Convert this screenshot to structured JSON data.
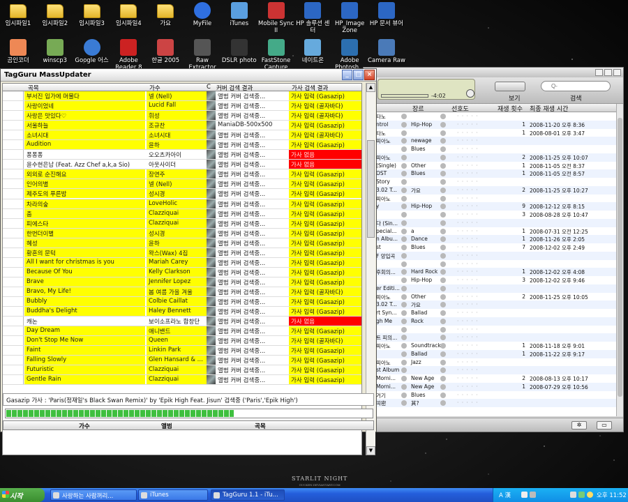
{
  "desktop": {
    "icons_row1": [
      {
        "label": "임시파일1",
        "icon": "folder-icon"
      },
      {
        "label": "임시파일2",
        "icon": "folder-icon"
      },
      {
        "label": "임시파일3",
        "icon": "folder-icon"
      },
      {
        "label": "임시파일4",
        "icon": "folder-icon"
      },
      {
        "label": "가요",
        "icon": "folder-icon"
      },
      {
        "label": "MyFile",
        "icon": "help-icon"
      },
      {
        "label": "iTunes",
        "icon": "itunes-icon"
      },
      {
        "label": "Mobile Sync II",
        "icon": "phone-icon"
      },
      {
        "label": "HP 솔루션 센터",
        "icon": "hp-icon"
      },
      {
        "label": "HP_Image Zone",
        "icon": "hp-image-icon"
      },
      {
        "label": "HP 문서 뷰어",
        "icon": "hp-doc-icon"
      }
    ],
    "icons_row2": [
      {
        "label": "곰인코더",
        "icon": "encoder-icon"
      },
      {
        "label": "winscp3",
        "icon": "winscp-icon"
      },
      {
        "label": "Google 어스",
        "icon": "globe-icon"
      },
      {
        "label": "Adobe Reader 8",
        "icon": "pdf-icon"
      },
      {
        "label": "한글 2005",
        "icon": "hangul-icon"
      },
      {
        "label": "Raw Extractor",
        "icon": "raw-icon"
      },
      {
        "label": "DSLR photo",
        "icon": "camera-icon"
      },
      {
        "label": "FastStone Capture",
        "icon": "capture-icon"
      },
      {
        "label": "네이트온",
        "icon": "nateon-icon"
      },
      {
        "label": "Adobe Photosh...",
        "icon": "photoshop-icon"
      },
      {
        "label": "Camera Raw",
        "icon": "camera-raw-icon"
      }
    ],
    "wallpaper_mark": "STARLIT NIGHT",
    "wallpaper_sub": "GUCKEN.DEVIANTART.COM"
  },
  "tagguru": {
    "title": "TagGuru MassUpdater",
    "columns": {
      "title": "곡목",
      "artist": "가수",
      "cover_short": "C",
      "cover": "커버 검색 결과",
      "lyric": "가사 검색 결과"
    },
    "rows": [
      {
        "title": "부서진 입가에 머물다",
        "artist": "넬 (Nell)",
        "cover": "앨범 커버 검색중...",
        "lyric": "가사 입력 (Gasazip)",
        "status": "ok"
      },
      {
        "title": "사랑이었네",
        "artist": "Lucid Fall",
        "cover": "앨범 커버 검색중...",
        "lyric": "가사 입력 (골자바다)",
        "status": "ok"
      },
      {
        "title": "사랑은 맛있다♡",
        "artist": "휘성",
        "cover": "앨범 커버 검색중...",
        "lyric": "가사 입력 (골자바다)",
        "status": "ok"
      },
      {
        "title": "서울하늘",
        "artist": "조규찬",
        "cover": "ManiaDB-500x500",
        "lyric": "가사 입력 (Gasazip)",
        "status": "ok"
      },
      {
        "title": "소녀시대",
        "artist": "소녀시대",
        "cover": "앨범 커버 검색중...",
        "lyric": "가사 입력 (골자바다)",
        "status": "ok"
      },
      {
        "title": "Audition",
        "artist": "윤하",
        "cover": "앨범 커버 검색중...",
        "lyric": "가사 입력 (Gasazip)",
        "status": "ok"
      },
      {
        "title": "퐁퐁퐁",
        "artist": "오오츠카아이",
        "cover": "앨범 커버 검색중...",
        "lyric": "가사 없음",
        "status": "err"
      },
      {
        "title": "윤수현은남 (Feat. Azz Chef a,k,a Sio)",
        "artist": "아웃사이더",
        "cover": "앨범 커버 검색중...",
        "lyric": "가사 없음",
        "status": "err"
      },
      {
        "title": "외외로 순진해요",
        "artist": "장연주",
        "cover": "앨범 커버 검색중...",
        "lyric": "가사 입력 (Gasazip)",
        "status": "ok"
      },
      {
        "title": "인어의별",
        "artist": "넬 (Nell)",
        "cover": "앨범 커버 검색중...",
        "lyric": "가사 입력 (Gasazip)",
        "status": "ok"
      },
      {
        "title": "제주도의 푸른밤",
        "artist": "성시경",
        "cover": "앨범 커버 검색중...",
        "lyric": "가사 입력 (Gasazip)",
        "status": "ok"
      },
      {
        "title": "차라의숲",
        "artist": "LoveHolic",
        "cover": "앨범 커버 검색중...",
        "lyric": "가사 입력 (Gasazip)",
        "status": "ok"
      },
      {
        "title": "춤",
        "artist": "Clazziquai",
        "cover": "앨범 커버 검색중...",
        "lyric": "가사 입력 (Gasazip)",
        "status": "ok"
      },
      {
        "title": "피에스타",
        "artist": "Clazziquai",
        "cover": "앨범 커버 검색중...",
        "lyric": "가사 입력 (Gasazip)",
        "status": "ok"
      },
      {
        "title": "한번더이별",
        "artist": "성시경",
        "cover": "앨범 커버 검색중...",
        "lyric": "가사 입력 (Gasazip)",
        "status": "ok"
      },
      {
        "title": "혜성",
        "artist": "윤하",
        "cover": "앨범 커버 검색중...",
        "lyric": "가사 입력 (Gasazip)",
        "status": "ok"
      },
      {
        "title": "황혼의 문턱",
        "artist": "왁스(Wax) 4집",
        "cover": "앨범 커버 검색중...",
        "lyric": "가사 입력 (Gasazip)",
        "status": "ok"
      },
      {
        "title": "All I want for christmas is you",
        "artist": "Mariah Carey",
        "cover": "앨범 커버 검색중...",
        "lyric": "가사 입력 (Gasazip)",
        "status": "ok"
      },
      {
        "title": "Because Of You",
        "artist": "Kelly Clarkson",
        "cover": "앨범 커버 검색중...",
        "lyric": "가사 입력 (Gasazip)",
        "status": "ok"
      },
      {
        "title": "Brave",
        "artist": "Jennifer Lopez",
        "cover": "앨범 커버 검색중...",
        "lyric": "가사 입력 (Gasazip)",
        "status": "ok"
      },
      {
        "title": "Bravo, My Life!",
        "artist": "봄 여름 가을 겨울",
        "cover": "앨범 커버 검색중...",
        "lyric": "가사 입력 (골자바다)",
        "status": "ok"
      },
      {
        "title": "Bubbly",
        "artist": "Colbie Caillat",
        "cover": "앨범 커버 검색중...",
        "lyric": "가사 입력 (Gasazip)",
        "status": "ok"
      },
      {
        "title": "Buddha's Delight",
        "artist": "Haley Bennett",
        "cover": "앨범 커버 검색중...",
        "lyric": "가사 입력 (Gasazip)",
        "status": "ok"
      },
      {
        "title": "캐논",
        "artist": "보이소프라노 합창단",
        "cover": "앨범 커버 검색중...",
        "lyric": "가사 없음",
        "status": "err"
      },
      {
        "title": "Day Dream",
        "artist": "애니밴드",
        "cover": "앨범 커버 검색중...",
        "lyric": "가사 입력 (Gasazip)",
        "status": "ok"
      },
      {
        "title": "Don't Stop Me Now",
        "artist": "Queen",
        "cover": "앨범 커버 검색중...",
        "lyric": "가사 입력 (골자바다)",
        "status": "ok"
      },
      {
        "title": "Faint",
        "artist": "Linkin Park",
        "cover": "앨범 커버 검색중...",
        "lyric": "가사 입력 (Gasazip)",
        "status": "ok"
      },
      {
        "title": "Falling Slowly",
        "artist": "Glen Hansard & ...",
        "cover": "앨범 커버 검색중...",
        "lyric": "가사 입력 (Gasazip)",
        "status": "ok"
      },
      {
        "title": "Futuristic",
        "artist": "Clazziquai",
        "cover": "앨범 커버 검색중...",
        "lyric": "가사 입력 (Gasazip)",
        "status": "ok"
      },
      {
        "title": "Gentle Rain",
        "artist": "Clazziquai",
        "cover": "앨범 커버 검색중...",
        "lyric": "가사 입력 (Gasazip)",
        "status": "ok"
      }
    ],
    "status_text": "Gasazip 가사 : 'Paris(정재일's Black Swan Remix)' by 'Epik High Feat. Jisun' 검색중 ('Paris','Epik High')",
    "progress_fraction": 0.62,
    "bottom": {
      "artist": "가수",
      "album": "앨범",
      "title": "곡목"
    }
  },
  "itunes": {
    "time": "-4:02",
    "view_label": "보기",
    "search_placeholder": "Q-",
    "search_label": "검색",
    "columns": {
      "genre": "장르",
      "rating": "선호도",
      "plays": "재생 횟수",
      "last_played": "최종 재생 시간"
    },
    "rows": [
      {
        "album": "타노",
        "genre": "",
        "plays": "",
        "last": ""
      },
      {
        "album": "ntrol",
        "genre": "Hip-Hop",
        "plays": "1",
        "last": "2008-11-20 오후 8:36"
      },
      {
        "album": "타노",
        "genre": "",
        "plays": "1",
        "last": "2008-08-01 오후 3:47"
      },
      {
        "album": "피아노",
        "genre": "newage",
        "plays": "",
        "last": ""
      },
      {
        "album": "",
        "genre": "Blues",
        "plays": "",
        "last": ""
      },
      {
        "album": "피아노",
        "genre": "",
        "plays": "2",
        "last": "2008-11-25 오후 10:07"
      },
      {
        "album": "(Single)",
        "genre": "Other",
        "plays": "1",
        "last": "2008-11-05 오전 8:37"
      },
      {
        "album": "OST",
        "genre": "Blues",
        "plays": "1",
        "last": "2008-11-05 오전 8:57"
      },
      {
        "album": "Story",
        "genre": "",
        "plays": "",
        "last": ""
      },
      {
        "album": "3.02 T...",
        "genre": "가요",
        "plays": "2",
        "last": "2008-11-25 오후 10:27"
      },
      {
        "album": "피아노",
        "genre": "",
        "plays": "",
        "last": ""
      },
      {
        "album": "y",
        "genre": "Hip-Hop",
        "plays": "9",
        "last": "2008-12-12 오후 8:15"
      },
      {
        "album": "",
        "genre": "",
        "plays": "3",
        "last": "2008-08-28 오후 10:47"
      },
      {
        "album": "다 (Sin...",
        "genre": "",
        "plays": "",
        "last": ""
      },
      {
        "album": "pecial...",
        "genre": "a",
        "plays": "1",
        "last": "2008-07-31 오전 12:25"
      },
      {
        "album": "n Albu...",
        "genre": "Dance",
        "plays": "1",
        "last": "2008-11-26 오후 2:05"
      },
      {
        "album": "st",
        "genre": "Blues",
        "plays": "7",
        "last": "2008-12-02 오후 2:49"
      },
      {
        "album": "F 앙입곡",
        "genre": "",
        "plays": "",
        "last": ""
      },
      {
        "album": "",
        "genre": "",
        "plays": "",
        "last": ""
      },
      {
        "album": "후회의...",
        "genre": "Hard Rock",
        "plays": "1",
        "last": "2008-12-02 오후 4:08"
      },
      {
        "album": "",
        "genre": "Hip-Hop",
        "plays": "3",
        "last": "2008-12-02 오후 9:46"
      },
      {
        "album": "er Editi...",
        "genre": "",
        "plays": "",
        "last": ""
      },
      {
        "album": "피아노",
        "genre": "Other",
        "plays": "2",
        "last": "2008-11-25 오후 10:05"
      },
      {
        "album": "3.02 T...",
        "genre": "가요",
        "plays": "",
        "last": ""
      },
      {
        "album": "rt Syn...",
        "genre": "Ballad",
        "plays": "",
        "last": ""
      },
      {
        "album": "gh Me",
        "genre": "Rock",
        "plays": "",
        "last": ""
      },
      {
        "album": "",
        "genre": "",
        "plays": "",
        "last": ""
      },
      {
        "album": "트 피의...",
        "genre": "",
        "plays": "",
        "last": ""
      },
      {
        "album": "피아노",
        "genre": "Soundtrack",
        "plays": "1",
        "last": "2008-11-18 오후 9:01"
      },
      {
        "album": "",
        "genre": "Ballad",
        "plays": "1",
        "last": "2008-11-22 오후 9:17"
      },
      {
        "album": "피아노",
        "genre": "Jazz",
        "plays": "",
        "last": ""
      },
      {
        "album": "st Album",
        "genre": "",
        "plays": "",
        "last": ""
      },
      {
        "album": "Morni...",
        "genre": "New Age",
        "plays": "2",
        "last": "2008-08-13 오후 10:17"
      },
      {
        "album": "Morni...",
        "genre": "New Age",
        "plays": "1",
        "last": "2008-07-29 오후 10:56"
      },
      {
        "album": "거기",
        "genre": "Blues",
        "plays": "",
        "last": ""
      },
      {
        "album": "띠密",
        "genre": "其?",
        "plays": "",
        "last": ""
      }
    ]
  },
  "taskbar": {
    "start_label": "시작",
    "tasks": [
      {
        "label": "사랑하는 사람꺼리...",
        "icon": "ie-icon"
      },
      {
        "label": "iTunes",
        "icon": "itunes-icon"
      },
      {
        "label": "TagGuru 1.1 - iTu...",
        "icon": "tagguru-icon"
      }
    ],
    "tray": {
      "ime": "A 漢",
      "clock": "오후 11:52"
    }
  }
}
